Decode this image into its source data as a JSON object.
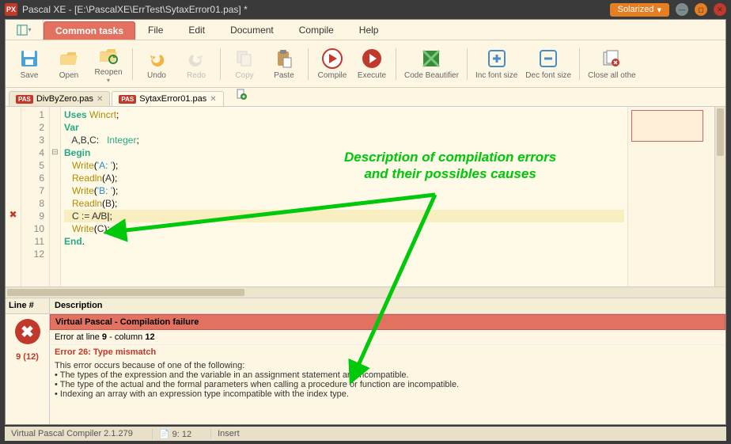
{
  "window": {
    "app_badge": "PX",
    "title": "Pascal XE  -  [E:\\PascalXE\\ErrTest\\SytaxError01.pas] *",
    "theme_label": "Solarized"
  },
  "menu": {
    "active_tab": "Common tasks",
    "items": [
      "File",
      "Edit",
      "Document",
      "Compile",
      "Help"
    ]
  },
  "toolbar": {
    "save": "Save",
    "open": "Open",
    "reopen": "Reopen",
    "undo": "Undo",
    "redo": "Redo",
    "copy": "Copy",
    "paste": "Paste",
    "compile": "Compile",
    "execute": "Execute",
    "beautifier": "Code Beautifier",
    "incfont": "Inc font size",
    "decfont": "Dec font size",
    "closeall": "Close all othe"
  },
  "file_tabs": {
    "items": [
      {
        "badge": "PAS",
        "name": "DivByZero.pas",
        "active": false
      },
      {
        "badge": "PAS",
        "name": "SytaxError01.pas",
        "active": true
      }
    ]
  },
  "code": {
    "lines": [
      {
        "n": 1,
        "html": "<span class='kw'>Uses</span> <span class='fn'>Wincrt</span>;"
      },
      {
        "n": 2,
        "html": "<span class='kw'>Var</span>"
      },
      {
        "n": 3,
        "html": "   <span class='var'>A</span>,<span class='var'>B</span>,<span class='var'>C</span>:   <span class='ty'>Integer</span>;"
      },
      {
        "n": 4,
        "html": "<span class='kw'>Begin</span>",
        "fold": "⊟"
      },
      {
        "n": 5,
        "html": "   <span class='fn'>Write</span>(<span class='str'>'A: '</span>);"
      },
      {
        "n": 6,
        "html": "   <span class='fn'>Readln</span>(<span class='var'>A</span>);"
      },
      {
        "n": 7,
        "html": "   <span class='fn'>Write</span>(<span class='str'>'B: '</span>);"
      },
      {
        "n": 8,
        "html": "   <span class='fn'>Readln</span>(<span class='var'>B</span>);"
      },
      {
        "n": 9,
        "html": "   <span class='var'>C</span> <span class='op'>:=</span> <span class='var'>A</span>/<span class='var'>B</span>|;",
        "hl": true,
        "mark": "✖"
      },
      {
        "n": 10,
        "html": "   <span class='fn'>Write</span>(<span class='var'>C</span>);"
      },
      {
        "n": 11,
        "html": "<span class='kw'>End</span>."
      },
      {
        "n": 12,
        "html": ""
      }
    ]
  },
  "errors": {
    "col_line": "Line #",
    "col_desc": "Description",
    "title": "Virtual Pascal - Compilation failure",
    "at_prefix": "Error at line ",
    "at_line": "9",
    "at_mid": " - column ",
    "at_col": "12",
    "rowref": "9 (12)",
    "name": "Error 26: Type mismatch",
    "intro": "This error occurs because of one of the following:",
    "bullets": [
      "The types of the expression and the variable in an assignment statement are incompatible.",
      "The type of the actual and the formal parameters when calling a procedure or function are incompatible.",
      "Indexing an array with an expression type incompatible with the index type."
    ]
  },
  "status": {
    "compiler": "Virtual Pascal Compiler 2.1.279",
    "pos": "9: 12",
    "mode": "Insert"
  },
  "annotation": {
    "line1": "Description of compilation errors",
    "line2": "and their possibles causes"
  }
}
